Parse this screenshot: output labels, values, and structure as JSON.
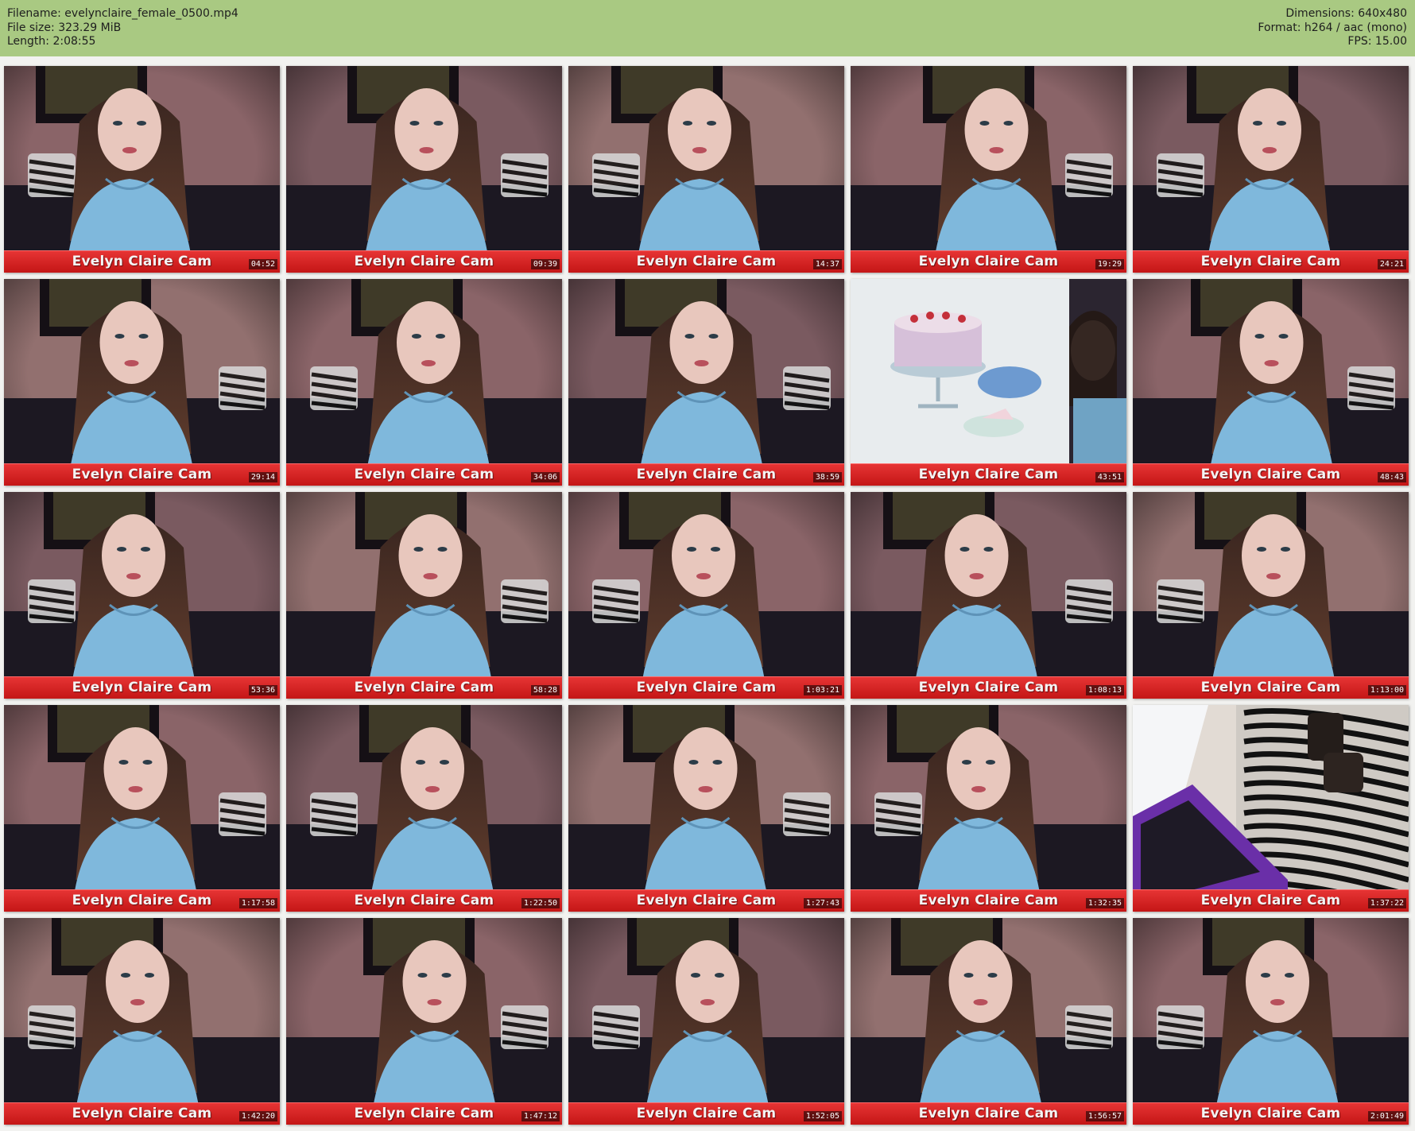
{
  "header": {
    "filename": "Filename: evelynclaire_female_0500.mp4",
    "filesize": "File size: 323.29 MiB",
    "length": "Length: 2:08:55",
    "dimensions": "Dimensions: 640x480",
    "format": "Format: h264 / aac (mono)",
    "fps": "FPS: 15.00"
  },
  "caption": "Evelyn Claire Cam",
  "colors": {
    "header_bg": "#a9c982",
    "caption_bar": "#d42121",
    "page_bg": "#f2f2f0"
  },
  "thumbnails": [
    {
      "time": "04:52",
      "scene": "cam"
    },
    {
      "time": "09:39",
      "scene": "cam"
    },
    {
      "time": "14:37",
      "scene": "cam"
    },
    {
      "time": "19:29",
      "scene": "cam"
    },
    {
      "time": "24:21",
      "scene": "cam"
    },
    {
      "time": "29:14",
      "scene": "cam"
    },
    {
      "time": "34:06",
      "scene": "cam"
    },
    {
      "time": "38:59",
      "scene": "cam"
    },
    {
      "time": "43:51",
      "scene": "painting"
    },
    {
      "time": "48:43",
      "scene": "cam"
    },
    {
      "time": "53:36",
      "scene": "cam"
    },
    {
      "time": "58:28",
      "scene": "cam"
    },
    {
      "time": "1:03:21",
      "scene": "cam"
    },
    {
      "time": "1:08:13",
      "scene": "cam"
    },
    {
      "time": "1:13:00",
      "scene": "cam"
    },
    {
      "time": "1:17:58",
      "scene": "cam"
    },
    {
      "time": "1:22:50",
      "scene": "cam"
    },
    {
      "time": "1:27:43",
      "scene": "cam"
    },
    {
      "time": "1:32:35",
      "scene": "cam"
    },
    {
      "time": "1:37:22",
      "scene": "laptop"
    },
    {
      "time": "1:42:20",
      "scene": "cam"
    },
    {
      "time": "1:47:12",
      "scene": "cam"
    },
    {
      "time": "1:52:05",
      "scene": "cam"
    },
    {
      "time": "1:56:57",
      "scene": "cam"
    },
    {
      "time": "2:01:49",
      "scene": "cam"
    }
  ]
}
